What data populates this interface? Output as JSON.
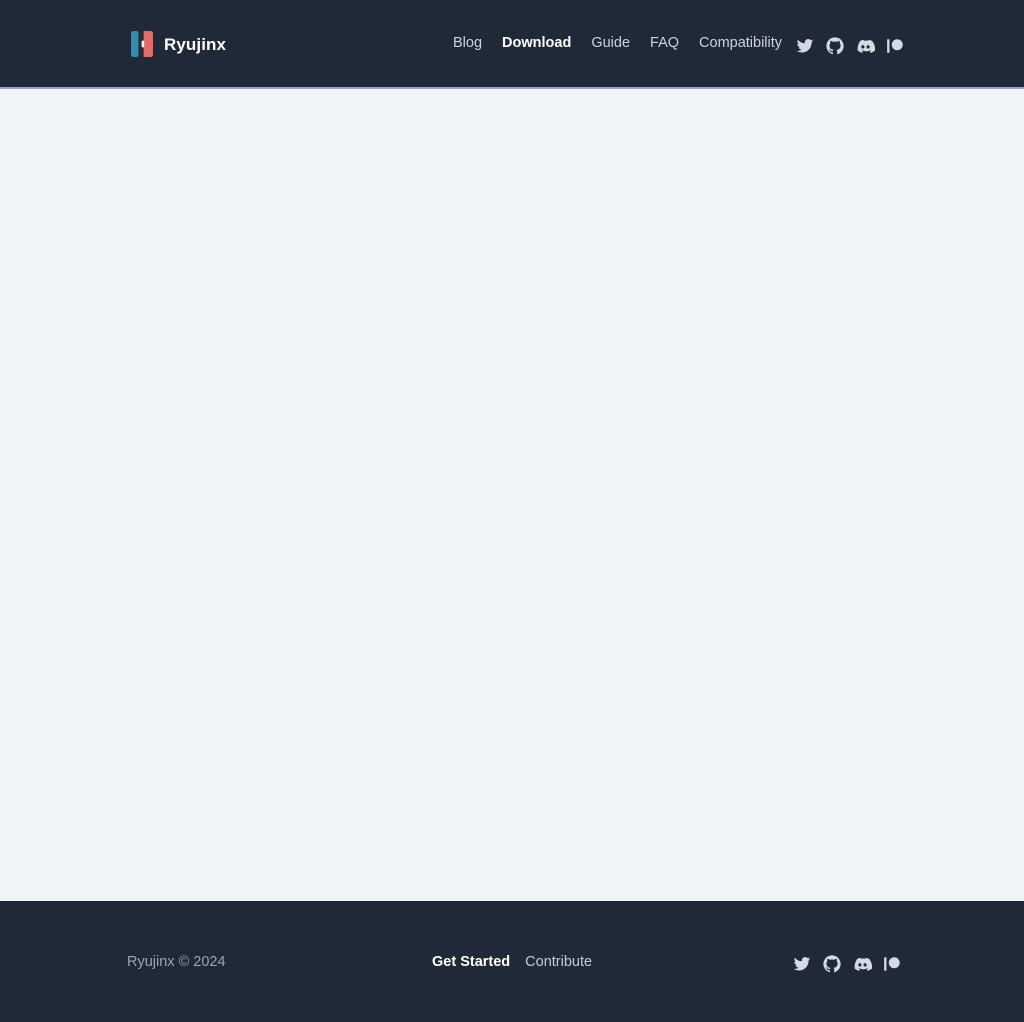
{
  "site": {
    "brand_name": "Ryujinx",
    "logo_icon": "switch-console-icon",
    "logo_left_color": "#2f8eae",
    "logo_right_color": "#e06c6c",
    "header_bg": "#1f2937",
    "body_bg": "#f1f4f6",
    "footer_bg": "#1f2937",
    "accent_border": "#8fa4c4"
  },
  "header": {
    "nav": [
      {
        "label": "Blog",
        "active": false
      },
      {
        "label": "Download",
        "active": true
      },
      {
        "label": "Guide",
        "active": false
      },
      {
        "label": "FAQ",
        "active": false
      },
      {
        "label": "Compatibility",
        "active": false
      }
    ],
    "socials": [
      {
        "name": "twitter-icon",
        "label": "Twitter"
      },
      {
        "name": "github-icon",
        "label": "GitHub"
      },
      {
        "name": "discord-icon",
        "label": "Discord"
      },
      {
        "name": "patreon-icon",
        "label": "Patreon"
      }
    ]
  },
  "main": {
    "content": ""
  },
  "footer": {
    "copyright": "Ryujinx © 2024",
    "links": [
      {
        "label": "Get Started",
        "strong": true
      },
      {
        "label": "Contribute",
        "strong": false
      }
    ],
    "socials": [
      {
        "name": "twitter-icon",
        "label": "Twitter"
      },
      {
        "name": "github-icon",
        "label": "GitHub"
      },
      {
        "name": "discord-icon",
        "label": "Discord"
      },
      {
        "name": "patreon-icon",
        "label": "Patreon"
      }
    ]
  }
}
